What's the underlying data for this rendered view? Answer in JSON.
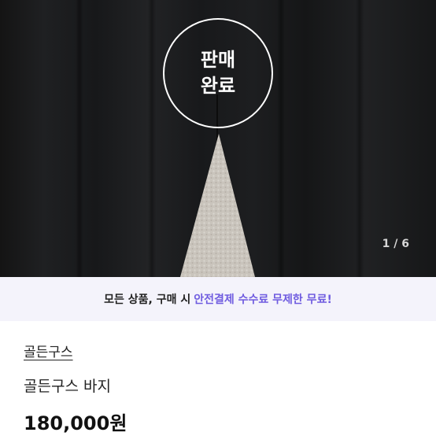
{
  "product_image": {
    "status_badge_line1": "판매",
    "status_badge_line2": "완료",
    "image_counter": "1 / 6"
  },
  "promo_banner": {
    "prefix": "모든 상품, 구매 시",
    "highlight": "안전결제 수수료 무제한 무료!",
    "highlight_color": "#6f5ce0"
  },
  "product_info": {
    "brand": "골든구스",
    "title": "골든구스 바지",
    "price": "180,000원"
  }
}
